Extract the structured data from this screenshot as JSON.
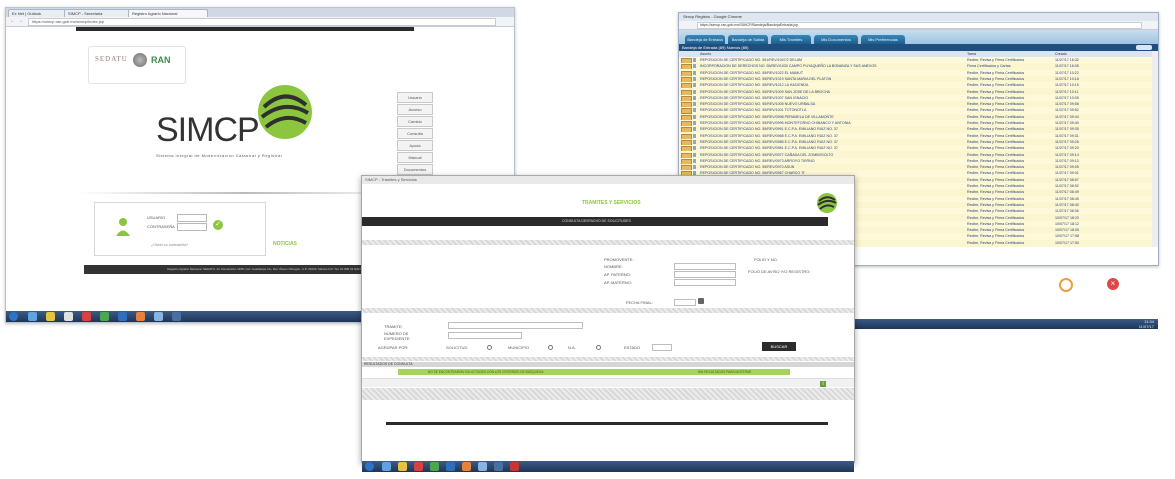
{
  "left_window": {
    "tabs": [
      "Ex Net | Outlook",
      "SIMCP - Secretaria",
      "Registro Agrario Nacional"
    ],
    "url": "https://simcp.ran.gob.mx/simcp/index.jsp",
    "logos": {
      "agency1": "SEDATU",
      "agency2": "RAN"
    },
    "app_title": "SIMCP",
    "app_subtitle": "Sistema Integral de Modernizacion Catastral y Registral",
    "side_menu": [
      "Usuario",
      "Acceso",
      "Cambio",
      "Consulta",
      "Ayuda",
      "Manual",
      "Documentos"
    ],
    "login": {
      "user_label": "USUARIO",
      "password_label": "CONTRASEÑA",
      "help_link": "¿Olvidó su contraseña?"
    },
    "news_label": "NOTICIAS",
    "footer_text": "Registro Agrario Nacional. SEDATU. Av. Revolución 1468, Col. Guadalupe Inn, Del. Álvaro Obregón, C.P. 01020, México D.F. Tel. 01 800 01 RAN"
  },
  "right_window": {
    "title": "Simcp Registro - Google Chrome",
    "url": "https://simcp.ran.gob.mx/SIMCP/Bandeja/BandejaEntrada.jsp",
    "nav_tabs": [
      "Bandeja de Entrada",
      "Bandeja de Salida",
      "Mis Tramites",
      "Mis Documentos",
      "Mis Preferencias"
    ],
    "inbox_header": "Bandeja de Entrada (89) Nuevos (89)",
    "columns": [
      "Asunto",
      "Tarea",
      "Creado"
    ],
    "rows": [
      {
        "asunto": "REPOSICION DE CERTIFICADO NO. 551/REV/1047/2 DELAM",
        "tarea": "Recibe, Revisa y Firma Certificados",
        "creado": "11/07/17 16:32"
      },
      {
        "asunto": "INCORPORACION DE DERECHOS NO. 55/REV/1030 CAMPO PUYAQUEÑO LA BONANZA Y SUS ANEXOS",
        "tarea": "Firma Certificados y Cartas",
        "creado": "11/07/17 16:05"
      },
      {
        "asunto": "REPOSICION DE CERTIFICADO NO. 55/REV/1022 EL MAMUT",
        "tarea": "Recibe, Revisa y Firma Certificados",
        "creado": "11/07/17 10:22"
      },
      {
        "asunto": "REPOSICION DE CERTIFICADO NO. 55/REV/1019 SANTA MARIA DEL PLATON",
        "tarea": "Recibe, Revisa y Firma Certificados",
        "creado": "11/07/17 10:18"
      },
      {
        "asunto": "REPOSICION DE CERTIFICADO NO. 55/REV/1012 LA HACIENDA",
        "tarea": "Recibe, Revisa y Firma Certificados",
        "creado": "11/07/17 10:15"
      },
      {
        "asunto": "REPOSICION DE CERTIFICADO NO. 55/REV/1009 SAN JOSE DE LA BROCHA",
        "tarea": "Recibe, Revisa y Firma Certificados",
        "creado": "11/07/17 10:11"
      },
      {
        "asunto": "REPOSICION DE CERTIFICADO NO. 55/REV/1007 SAN IGNACIO",
        "tarea": "Recibe, Revisa y Firma Certificados",
        "creado": "11/07/17 10:05"
      },
      {
        "asunto": "REPOSICION DE CERTIFICADO NO. 55/REV/1005 NUEVO URBALSA",
        "tarea": "Recibe, Revisa y Firma Certificados",
        "creado": "11/07/17 09:58"
      },
      {
        "asunto": "REPOSICION DE CERTIFICADO NO. 55/REV/1001 TOTONOTLA",
        "tarea": "Recibe, Revisa y Firma Certificados",
        "creado": "11/07/17 09:52"
      },
      {
        "asunto": "REPOSICION DE CERTIFICADO NO. 55/REV/0998 PERAMELA DE VILLAMONTE",
        "tarea": "Recibe, Revisa y Firma Certificados",
        "creado": "11/07/17 09:44"
      },
      {
        "asunto": "REPOSICION DE CERTIFICADO NO. 55/REV/0995 MONTEFORNO CHINANCO Y ANTONIA",
        "tarea": "Recibe, Revisa y Firma Certificados",
        "creado": "11/07/17 09:40"
      },
      {
        "asunto": "REPOSICION DE CERTIFICADO NO. 55/REV/0991 E.C.P.A. EMILIANO RUIZ NO. 37",
        "tarea": "Recibe, Revisa y Firma Certificados",
        "creado": "11/07/17 09:35"
      },
      {
        "asunto": "REPOSICION DE CERTIFICADO NO. 55/REV/0988 E.C.P.A. EMILIANO RUIZ NO. 37",
        "tarea": "Recibe, Revisa y Firma Certificados",
        "creado": "11/07/17 09:31"
      },
      {
        "asunto": "REPOSICION DE CERTIFICADO NO. 55/REV/0985 E.C.P.A. EMILIANO RUIZ NO. 37",
        "tarea": "Recibe, Revisa y Firma Certificados",
        "creado": "11/07/17 09:26"
      },
      {
        "asunto": "REPOSICION DE CERTIFICADO NO. 55/REV/0981 E.C.P.A. EMILIANO RUIZ NO. 37",
        "tarea": "Recibe, Revisa y Firma Certificados",
        "creado": "11/07/17 09:20"
      },
      {
        "asunto": "REPOSICION DE CERTIFICADO NO. 55/REV/0977 CAÑADA DEL ZOMBOSOLTO",
        "tarea": "Recibe, Revisa y Firma Certificados",
        "creado": "11/07/17 09:14"
      },
      {
        "asunto": "REPOSICION DE CERTIFICADO NO. 55/REV/0973 ARROYO TIERNO",
        "tarea": "Recibe, Revisa y Firma Certificados",
        "creado": "11/07/17 09:10"
      },
      {
        "asunto": "REPOSICION DE CERTIFICADO NO. 55/REV/0970 ASUN",
        "tarea": "Recibe, Revisa y Firma Certificados",
        "creado": "11/07/17 09:05"
      },
      {
        "asunto": "REPOSICION DE CERTIFICADO NO. 55/REV/0967 CHARCO 'S'",
        "tarea": "Recibe, Revisa y Firma Certificados",
        "creado": "11/07/17 09:01"
      },
      {
        "asunto": "REPOSICION DE CERTIFICADO NO. 55/REV/0963 AC",
        "tarea": "Recibe, Revisa y Firma Certificados",
        "creado": "11/07/17 08:57"
      },
      {
        "asunto": "REPOSICION DE CERTIFICADO NO. 55/REV/0960 NUMERO 816",
        "tarea": "Recibe, Revisa y Firma Certificados",
        "creado": "11/07/17 08:52"
      },
      {
        "asunto": "REPOSICION DE CERTIFICADO NO. 55/REV/0957 NUMERO 816",
        "tarea": "Recibe, Revisa y Firma Certificados",
        "creado": "11/07/17 08:49"
      },
      {
        "asunto": "REPOSICION DE CERTIFICADO NO. 55/REV/0954 NUMERO 816",
        "tarea": "Recibe, Revisa y Firma Certificados",
        "creado": "11/07/17 08:45"
      },
      {
        "asunto": "REPOSICION DE CERTIFICADO NO. 55/REV/0951 NUMERO 816",
        "tarea": "Recibe, Revisa y Firma Certificados",
        "creado": "11/07/17 08:40"
      },
      {
        "asunto": "REPOSICION DE CERTIFICADO NO. 55/REV/0948 NUMERO 816",
        "tarea": "Recibe, Revisa y Firma Certificados",
        "creado": "11/07/17 08:36"
      },
      {
        "asunto": "REPOSICION DE CERTIFICADO NO. 55/REV/0945 SANTOS",
        "tarea": "Recibe, Revisa y Firma Certificados",
        "creado": "10/07/17 18:20"
      },
      {
        "asunto": "REPOSICION DE CERTIFICADO NO. 55/REV/0942 SANTOS",
        "tarea": "Recibe, Revisa y Firma Certificados",
        "creado": "10/07/17 18:12"
      },
      {
        "asunto": "REPOSICION DE CERTIFICADO NO. 55/REV/0939 SANTOS",
        "tarea": "Recibe, Revisa y Firma Certificados",
        "creado": "10/07/17 18:05"
      },
      {
        "asunto": "REPOSICION DE CERTIFICADO NO. 55/REV/0936 BAJIO",
        "tarea": "Recibe, Revisa y Firma Certificados",
        "creado": "10/07/17 17:58"
      },
      {
        "asunto": "REPOSICION DE CERTIFICADO NO. 55/REV/0933 MIL",
        "tarea": "Recibe, Revisa y Firma Certificados",
        "creado": "10/07/17 17:50"
      }
    ]
  },
  "center_window": {
    "title": "SIMCP - Tramites y Servicios",
    "header_title": "TRAMITES Y SERVICIOS",
    "subheader": "CONSULTA DESPACHO DE SOLICITUDES",
    "form": {
      "promovente": "PROMOVENTE:",
      "nombre": "NOMBRE:",
      "ap_paterno": "AP. PATERNO:",
      "ap_materno": "AP. MATERNO:",
      "fecha_inicial": "FOLIO Y NO.",
      "fecha_label2": "FOLIO DE AVISO Y/O REGISTRO:",
      "fecha_final": "FECHA FINAL:",
      "tramite": "TRAMITE:",
      "numero_expediente": "NÚMERO DE EXPEDIENTE:",
      "agrupar_por": "AGRUPAR POR:",
      "options": [
        "SOLICITUD",
        "MUNICIPIO",
        "N.A.",
        "ESTADO"
      ],
      "search_button": "BUSCAR"
    },
    "results_header": "RESULTADOS DE CONSULTA",
    "results_text": "NO SE ENCONTRARON SOLICITUDES CON LOS CRITERIOS DE BÚSQUEDA",
    "results_text2": "SIN RESULTADOS PARA MOSTRAR"
  },
  "colors": {
    "accent_green": "#8cc63f",
    "dark_bar": "#2b2b2b",
    "taskbar": "#1e3558",
    "nav_blue": "#1c5f8e",
    "grid_yellow": "#fbf6cf"
  },
  "icons": [
    "simcp-logo-icon",
    "check-icon",
    "user-icon",
    "print-icon",
    "close-icon",
    "calendar-icon"
  ]
}
